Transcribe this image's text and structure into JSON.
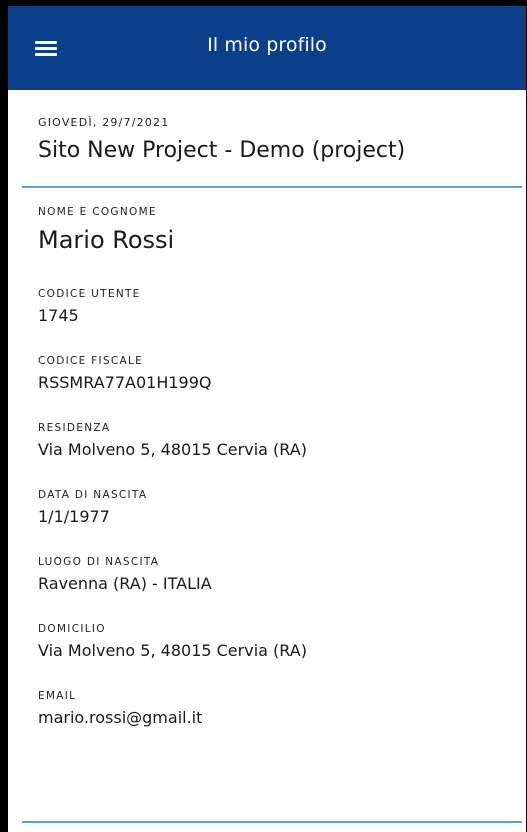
{
  "appbar": {
    "title": "Il mio profilo",
    "menu_icon": "hamburger-menu-icon",
    "color": "#0b3f8a"
  },
  "header": {
    "date": "GIOVEDÌ, 29/7/2021",
    "site": "Sito New Project - Demo (project)"
  },
  "profile": {
    "name_label": "NOME E COGNOME",
    "name": "Mario Rossi",
    "user_code_label": "CODICE UTENTE",
    "user_code": "1745",
    "fiscal_code_label": "CODICE FISCALE",
    "fiscal_code": "RSSMRA77A01H199Q",
    "residence_label": "RESIDENZA",
    "residence": "Via Molveno 5, 48015 Cervia (RA)",
    "birth_date_label": "DATA DI NASCITA",
    "birth_date": "1/1/1977",
    "birth_place_label": "LUOGO DI NASCITA",
    "birth_place": "Ravenna (RA) - ITALIA",
    "domicile_label": "DOMICILIO",
    "domicile": "Via Molveno 5, 48015 Cervia (RA)",
    "email_label": "EMAIL",
    "email": "mario.rossi@gmail.it"
  },
  "accent_color": "#5ea0d6"
}
